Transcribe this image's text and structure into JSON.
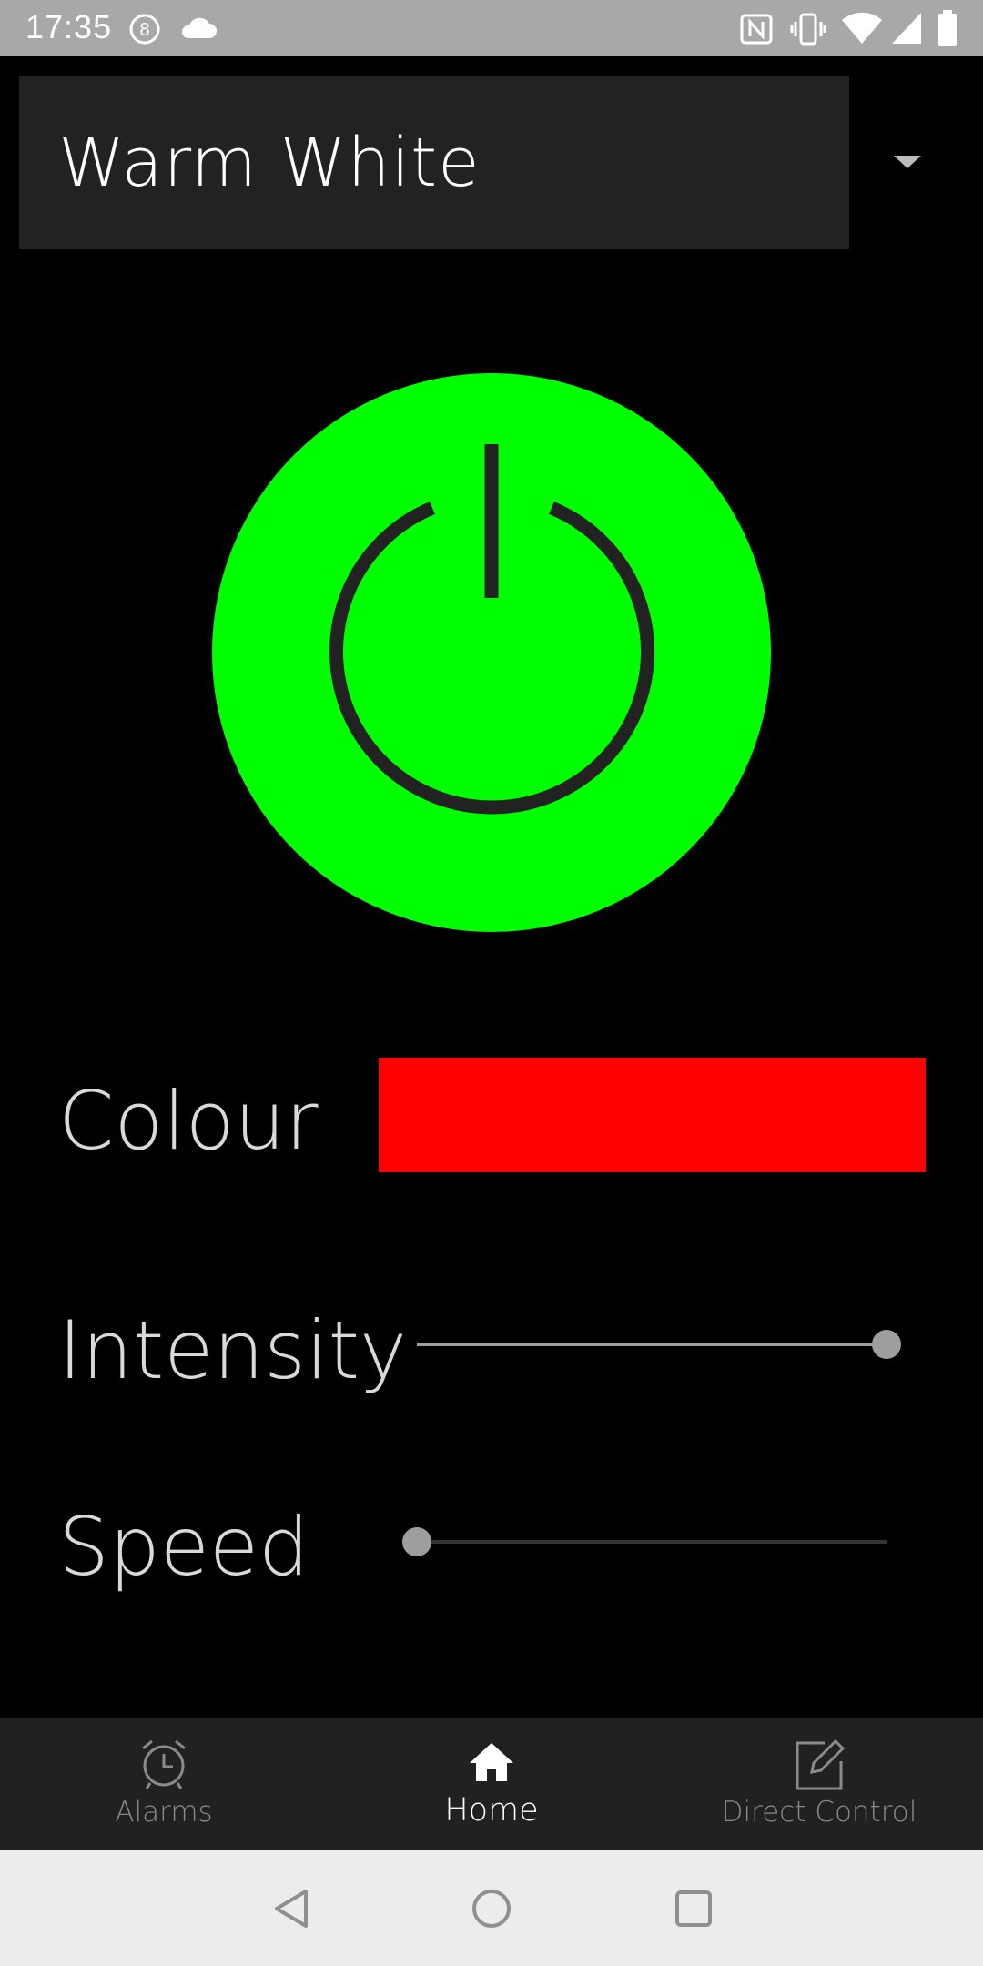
{
  "status_bar": {
    "time": "17:35",
    "icons": [
      "notification-badge-icon",
      "cloud-icon",
      "nfc-icon",
      "vibrate-icon",
      "wifi-icon",
      "cell-signal-icon",
      "battery-icon"
    ]
  },
  "mode_select": {
    "selected": "Warm White"
  },
  "power": {
    "state": "on",
    "color": "#00ff00"
  },
  "controls": {
    "colour": {
      "label": "Colour",
      "value": "#ff0000"
    },
    "intensity": {
      "label": "Intensity",
      "value": 1.0
    },
    "speed": {
      "label": "Speed",
      "value": 0.0
    }
  },
  "bottom_nav": {
    "items": [
      {
        "label": "Alarms",
        "icon": "alarm-clock-icon",
        "active": false
      },
      {
        "label": "Home",
        "icon": "home-icon",
        "active": true
      },
      {
        "label": "Direct Control",
        "icon": "edit-icon",
        "active": false
      }
    ]
  },
  "system_nav": {
    "buttons": [
      "back-icon",
      "home-circle-icon",
      "recents-icon"
    ]
  }
}
